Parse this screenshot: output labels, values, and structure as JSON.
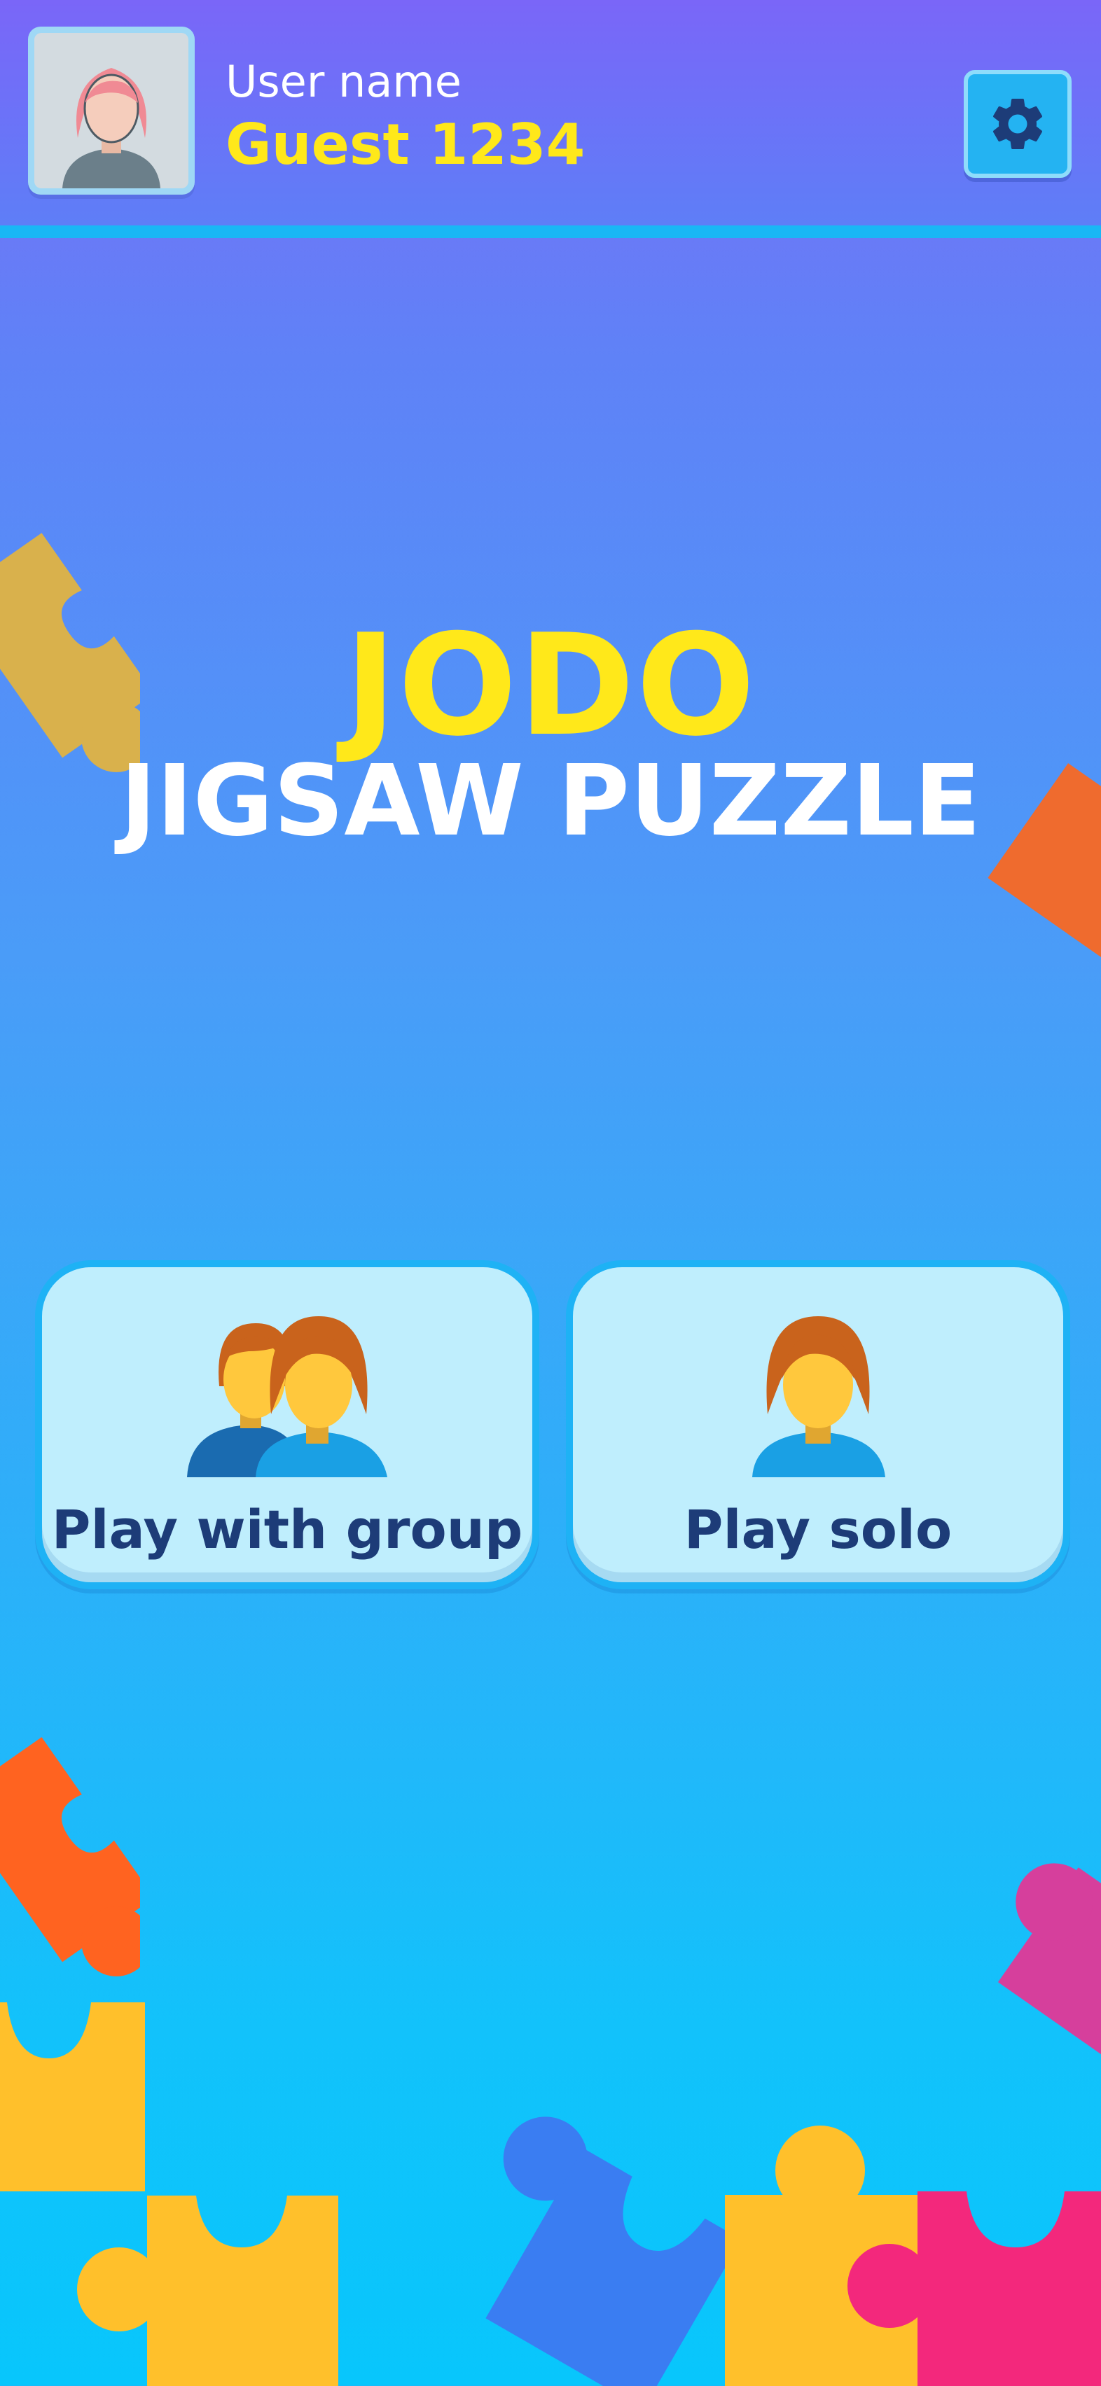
{
  "header": {
    "user_label": "User name",
    "user_value": "Guest 1234",
    "avatar_icon": "woman-avatar-icon",
    "settings_icon": "gear-icon"
  },
  "title": {
    "line1": "JODO",
    "line2": "JIGSAW PUZZLE"
  },
  "modes": [
    {
      "label": "Play with group",
      "icon": "group-people-icon"
    },
    {
      "label": "Play solo",
      "icon": "single-person-icon"
    }
  ],
  "colors": {
    "accent_yellow": "#ffe81a",
    "card_bg": "#bfeefd",
    "card_border": "#1eb2f5",
    "card_text": "#1d3c78",
    "header_bg": "#6c72f7"
  }
}
